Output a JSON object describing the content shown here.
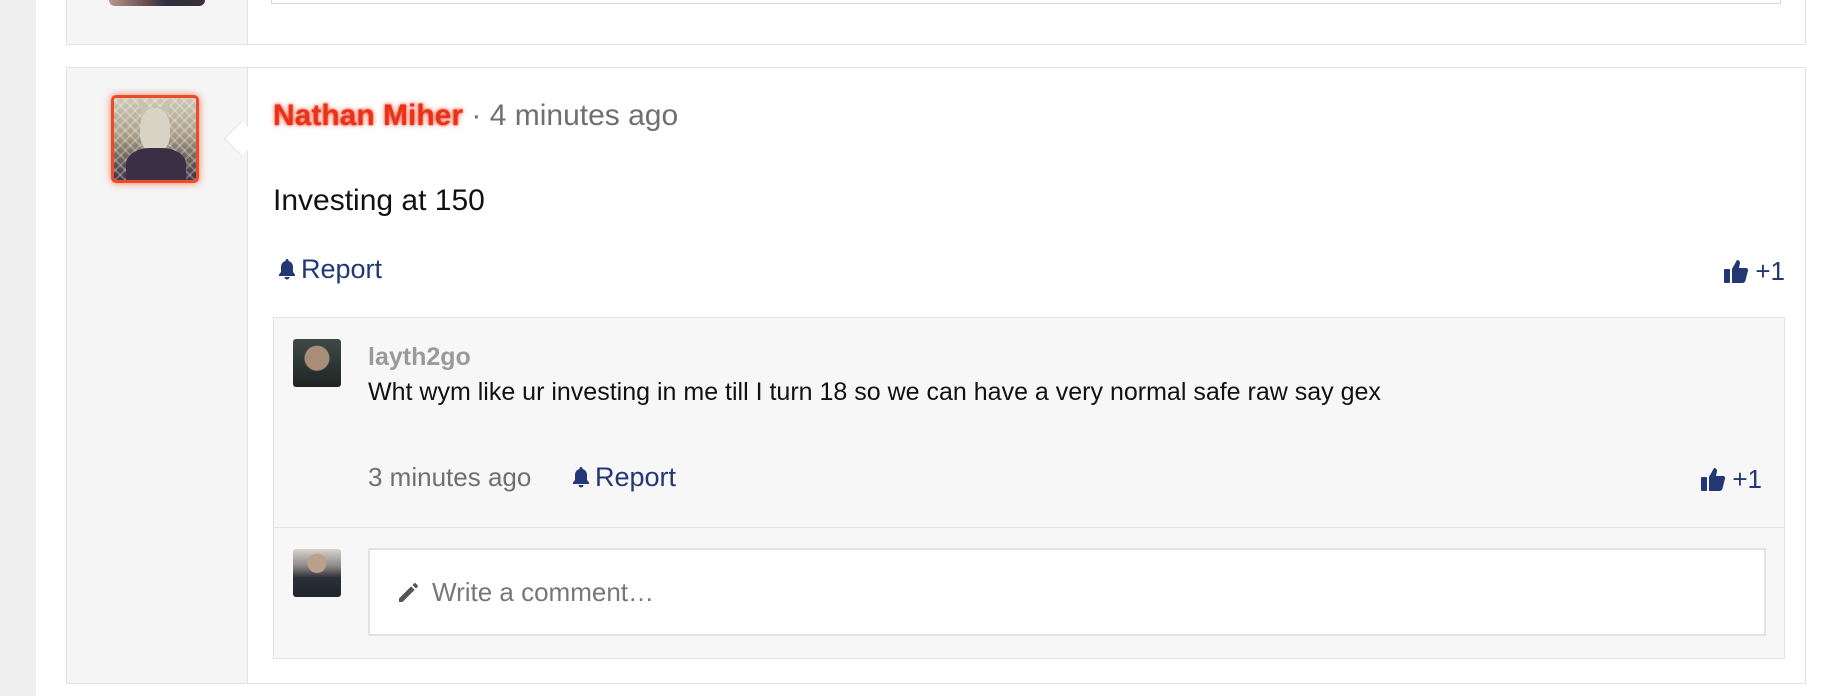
{
  "post": {
    "author": "Nathan Miher",
    "separator": "·",
    "time": "4 minutes ago",
    "text": "Investing at 150",
    "report_label": "Report",
    "like_label": "+1"
  },
  "reply": {
    "author": "layth2go",
    "text": "Wht wym like ur investing in me till I turn 18 so we can have a very normal safe raw say gex",
    "time": "3 minutes ago",
    "report_label": "Report",
    "like_label": "+1"
  },
  "comment_box": {
    "placeholder": "Write a comment…"
  },
  "colors": {
    "author_highlight": "#e8331a",
    "link": "#233775",
    "muted": "#6f6f6f"
  },
  "icons": {
    "report": "bell-icon",
    "like": "thumbs-up-icon",
    "comment": "pencil-icon"
  }
}
